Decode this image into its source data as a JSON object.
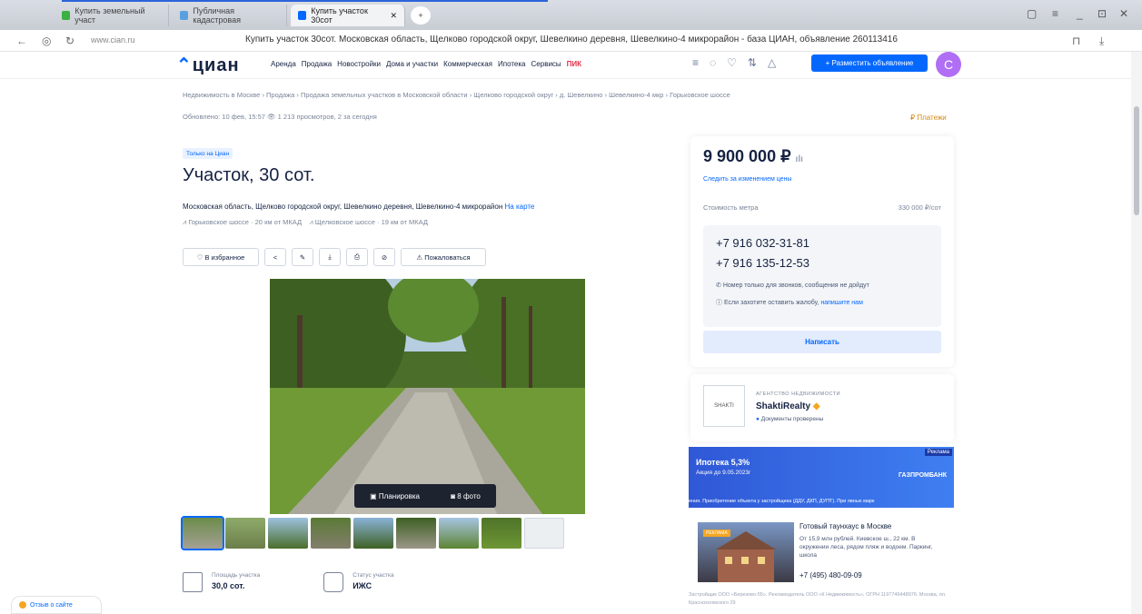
{
  "browser": {
    "tabs": [
      "Купить земельный участ",
      "Публичная кадастровая",
      "Купить участок 30сот"
    ],
    "url": "www.cian.ru",
    "page_title": "Купить участок 30сот. Московская область, Щелково городской округ, Шевелкино деревня, Шевелкино-4 микрорайон - база ЦИАН, объявление 260113416"
  },
  "header": {
    "logo": "циан",
    "nav": [
      "Аренда",
      "Продажа",
      "Новостройки",
      "Дома и участки",
      "Коммерческая",
      "Ипотека",
      "Сервисы",
      "ПИК"
    ],
    "post_button": "+ Разместить объявление",
    "avatar_letter": "С"
  },
  "listing": {
    "breadcrumbs": "Недвижимость в Москве  ›  Продажа  ›  Продажа земельных участков в Московской области  ›  Щелково городской округ  ›  д. Шевелкино  ›  Шевелкино-4 мкр  ›  Горьковское шоссе",
    "updated": "Обновлено: 10 фев, 15:57    👁 1 213 просмотров, 2 за сегодня",
    "payments": "₽ Платежи",
    "badge": "Только на Циан",
    "title": "Участок, 30 сот.",
    "address": "Московская область, Щелково городской округ, Шевелкино деревня, Шевелкино-4 микрорайон",
    "map_link": "На карте",
    "highway1": "Горьковское шоссе · 20 км от МКАД",
    "highway2": "Щелковское шоссе · 19 км от МКАД",
    "favorite": "В избранное",
    "complain": "Пожаловаться",
    "plan_chip": "Планировка",
    "photo_chip": "8 фото",
    "area_label": "Площадь участка",
    "area_value": "30,0 сот.",
    "status_label": "Статус участка",
    "status_value": "ИЖС"
  },
  "sidebar": {
    "price": "9 900 000 ₽",
    "track": "Следить за изменением цены",
    "sqm_label": "Стоимость метра",
    "sqm_value": "330 000 ₽/сот",
    "phone1": "+7 916 032-31-81",
    "phone2": "+7 916 135-12-53",
    "note1": "Номер только для звонков, сообщения не дойдут",
    "note2": "Если захотите оставить жалобу,",
    "note2_link": "напишите нам",
    "write": "Написать",
    "agency_small": "АГЕНТСТВО НЕДВИЖИМОСТИ",
    "agency_name": "ShaktiRealty",
    "agency_docs": "Документы проверены",
    "agency_logo": "SHAKTI"
  },
  "ad": {
    "label": "Реклама",
    "title": "Ипотека 5,3%",
    "sub": "Акция до 9.05.2023г",
    "brand": "ГАЗПРОМБАНК",
    "foot": "ения. Приобретение объекта у застройщика (ДДУ, ДКП, ДУПТ). При явных марк"
  },
  "house_ad": {
    "tag": "РЕКЛАМА",
    "name": "Готовый таунхаус в Москве",
    "desc": "От 15,9 млн рублей. Киевское ш., 22 км. В окружении леса, рядом пляж и водоем. Паркинг, школа",
    "phone": "+7 (495) 480-09-09",
    "foot": "Застройщик ООО «Березово-55». Рекламодатель ООО «К Недвижимость», ОГРН 1197746448976. Москва, пл. Краснохолмского 29"
  },
  "feedback": "Отзыв о сайте"
}
